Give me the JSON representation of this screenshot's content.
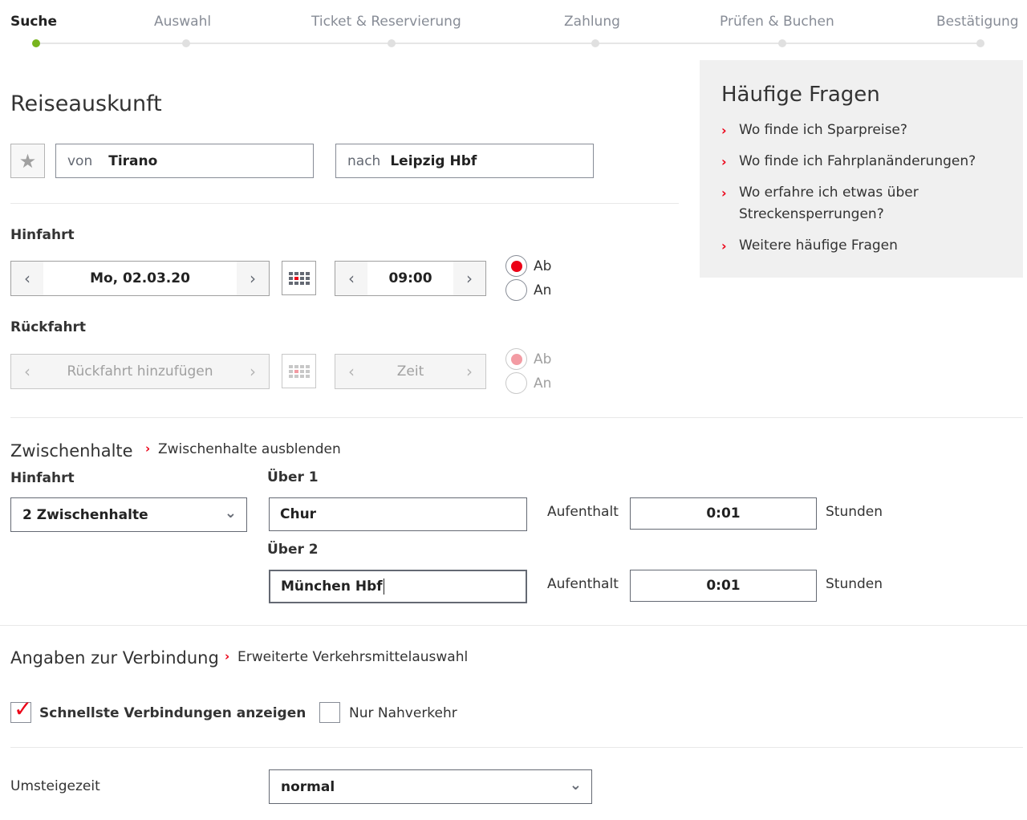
{
  "steps": [
    "Suche",
    "Auswahl",
    "Ticket & Reservierung",
    "Zahlung",
    "Prüfen & Buchen",
    "Bestätigung"
  ],
  "faq": {
    "title": "Häufige Fragen",
    "items": [
      "Wo finde ich Sparpreise?",
      "Wo finde ich Fahrplanänderungen?",
      "Wo erfahre ich etwas über Streckensperrungen?",
      "Weitere häufige Fragen"
    ]
  },
  "search": {
    "title": "Reiseauskunft",
    "from_prefix": "von",
    "from_value": "Tirano",
    "to_prefix": "nach",
    "to_value": "Leipzig Hbf"
  },
  "outbound": {
    "label": "Hinfahrt",
    "date": "Mo, 02.03.20",
    "time": "09:00",
    "radio_dep": "Ab",
    "radio_arr": "An",
    "selected": "Ab"
  },
  "return": {
    "label": "Rückfahrt",
    "date_placeholder": "Rückfahrt hinzufügen",
    "time_placeholder": "Zeit",
    "radio_dep": "Ab",
    "radio_arr": "An",
    "selected": "Ab"
  },
  "stops": {
    "title": "Zwischenhalte",
    "toggle_link": "Zwischenhalte ausblenden",
    "leg_label": "Hinfahrt",
    "count_selected": "2 Zwischenhalte",
    "via": [
      {
        "label": "Über 1",
        "station": "Chur",
        "stay_label": "Aufenthalt",
        "stay": "0:01",
        "unit": "Stunden"
      },
      {
        "label": "Über 2",
        "station": "München Hbf",
        "stay_label": "Aufenthalt",
        "stay": "0:01",
        "unit": "Stunden"
      }
    ]
  },
  "connection": {
    "title": "Angaben zur Verbindung",
    "advanced_link": "Erweiterte Verkehrsmittelauswahl",
    "fastest_label": "Schnellste Verbindungen anzeigen",
    "fastest_checked": true,
    "local_label": "Nur Nahverkehr",
    "local_checked": false,
    "transfer_label": "Umsteigezeit",
    "transfer_value": "normal"
  },
  "colors": {
    "accent": "#ec0016",
    "progress_active": "#78b41e",
    "faq_bg": "#f0f0f0"
  }
}
